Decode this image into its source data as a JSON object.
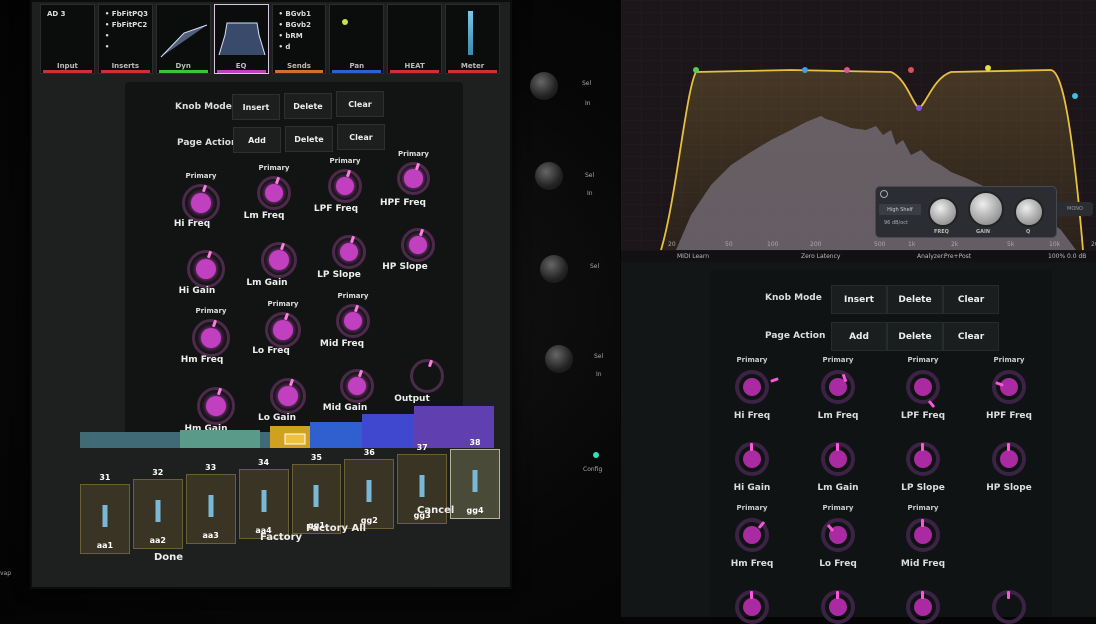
{
  "tablet": {
    "tabs": [
      {
        "label": "Input",
        "lines": [
          "AD 3"
        ],
        "color": "#d03030"
      },
      {
        "label": "Inserts",
        "lines": [
          "• FbFitPQ3",
          "• FbFitPC2",
          "•",
          "•"
        ],
        "color": "#d03030"
      },
      {
        "label": "Dyn",
        "lines": [],
        "color": "#40c040"
      },
      {
        "label": "EQ",
        "lines": [],
        "color": "#c040c0"
      },
      {
        "label": "Sends",
        "lines": [
          "• BGvb1",
          "• BGvb2",
          "• bRM",
          "• d"
        ],
        "color": "#d07030"
      },
      {
        "label": "Pan",
        "lines": [],
        "color": "#3060d0"
      },
      {
        "label": "HEAT",
        "lines": [],
        "color": "#d03030"
      },
      {
        "label": "Meter",
        "lines": [],
        "color": "#d03030"
      }
    ],
    "knob_mode_label": "Knob Mode",
    "page_action_label": "Page Action",
    "buttons": [
      "Insert",
      "Delete",
      "Clear",
      "Add",
      "Delete",
      "Clear"
    ],
    "primary_label": "Primary",
    "knobs": [
      "Hi Freq",
      "Lm Freq",
      "LPF Freq",
      "HPF Freq",
      "Hi Gain",
      "Lm Gain",
      "LP Slope",
      "HP Slope",
      "Hm Freq",
      "Lo Freq",
      "Mid Freq",
      "Hm Gain",
      "Lo Gain",
      "Mid Gain",
      "Output"
    ],
    "pads": [
      {
        "num": "31",
        "name": "aa1"
      },
      {
        "num": "32",
        "name": "aa2"
      },
      {
        "num": "33",
        "name": "aa3"
      },
      {
        "num": "34",
        "name": "aa4"
      },
      {
        "num": "35",
        "name": "gg1"
      },
      {
        "num": "36",
        "name": "gg2"
      },
      {
        "num": "37",
        "name": "gg3"
      },
      {
        "num": "38",
        "name": "gg4"
      }
    ],
    "bottom": [
      "Done",
      "Factory",
      "Factory All",
      "Cancel"
    ],
    "hw_labels": [
      "Sel",
      "In",
      "Sel",
      "In",
      "Sel",
      "Sel",
      "In",
      "Config",
      "vap"
    ]
  },
  "eq": {
    "freq_ticks": [
      "20",
      "50",
      "100",
      "200",
      "500",
      "1k",
      "2k",
      "5k",
      "10k",
      "20k"
    ],
    "band": {
      "shape": "High Shelf",
      "slope": "96 dB/oct",
      "freq_label": "FREQ",
      "gain_label": "GAIN",
      "q_label": "Q",
      "mono": "MONO",
      "mode": "0"
    },
    "status": {
      "midi": "MIDI Learn",
      "latency": "Zero Latency",
      "analyzer_label": "Analyzer:",
      "analyzer_val": "Pre+Post",
      "zoom": "100%",
      "gain": "0.0 dB"
    },
    "colors": {
      "curve": "#e8c040",
      "node_violet": "#8050e0",
      "node_pink": "#e050a0",
      "node_blue": "#40c0e0",
      "node_yellow": "#e0e040"
    }
  },
  "right": {
    "knob_mode_label": "Knob Mode",
    "page_action_label": "Page Action",
    "buttons": [
      "Insert",
      "Delete",
      "Clear",
      "Add",
      "Delete",
      "Clear"
    ],
    "primary_label": "Primary",
    "knobs": [
      "Hi Freq",
      "Lm Freq",
      "LPF Freq",
      "HPF Freq",
      "Hi Gain",
      "Lm Gain",
      "LP Slope",
      "HP Slope",
      "Hm Freq",
      "Lo Freq",
      "Mid Freq"
    ]
  }
}
